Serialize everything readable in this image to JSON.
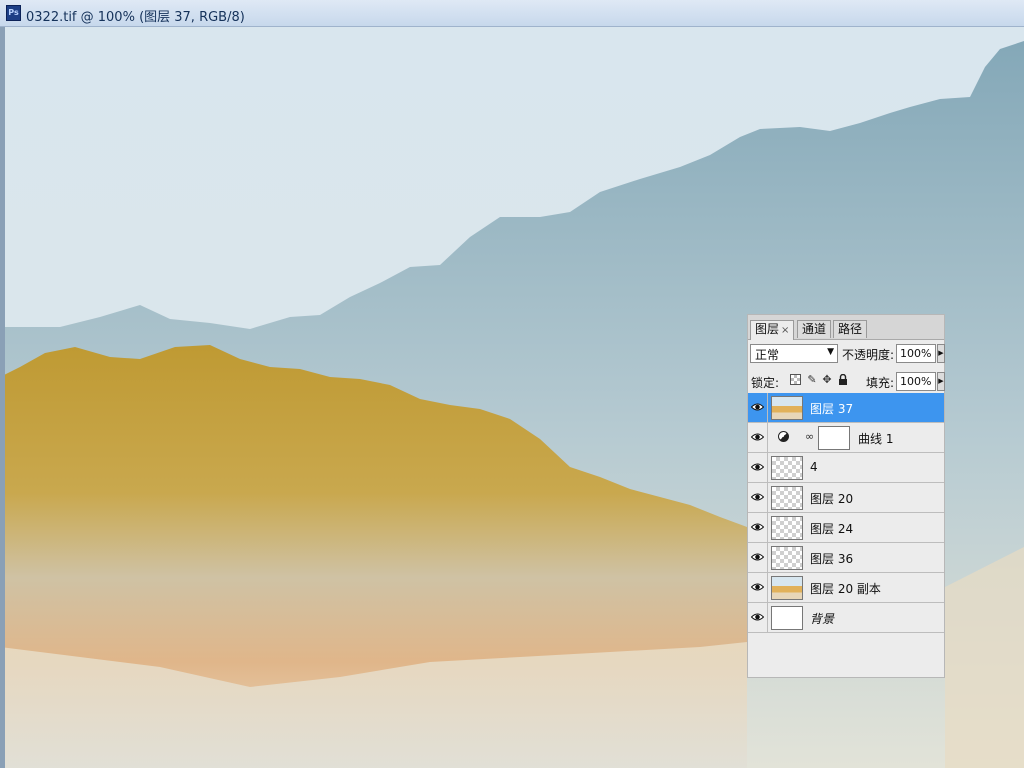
{
  "window": {
    "app_icon": "Ps",
    "title": "0322.tif @ 100% (图层 37, RGB/8)"
  },
  "colors": {
    "sky": "#d4e2ea",
    "mountain_blue": "#8fb0bf",
    "mountain_gold": "#c4a03c",
    "ochre": "#d99a55",
    "selected_row": "#3d95ef"
  },
  "layers_panel": {
    "tabs": [
      {
        "label": "图层",
        "close": "×"
      },
      {
        "label": "通道"
      },
      {
        "label": "路径"
      }
    ],
    "blend_mode": "正常",
    "opacity_label": "不透明度:",
    "opacity_value": "100%",
    "lock_label": "锁定:",
    "fill_label": "填充:",
    "fill_value": "100%",
    "layers": [
      {
        "name": "图层 37",
        "thumb": "artwork",
        "visible": true,
        "selected": true
      },
      {
        "name": "曲线 1",
        "thumb": "adjustment-curves",
        "visible": true,
        "selected": false
      },
      {
        "name": "4",
        "thumb": "transparent",
        "visible": true,
        "selected": false
      },
      {
        "name": "图层 20",
        "thumb": "transparent",
        "visible": true,
        "selected": false
      },
      {
        "name": "图层 24",
        "thumb": "transparent",
        "visible": true,
        "selected": false
      },
      {
        "name": "图层 36",
        "thumb": "transparent",
        "visible": true,
        "selected": false
      },
      {
        "name": "图层 20 副本",
        "thumb": "artwork",
        "visible": true,
        "selected": false
      },
      {
        "name": "背景",
        "thumb": "white",
        "visible": true,
        "selected": false
      }
    ]
  }
}
